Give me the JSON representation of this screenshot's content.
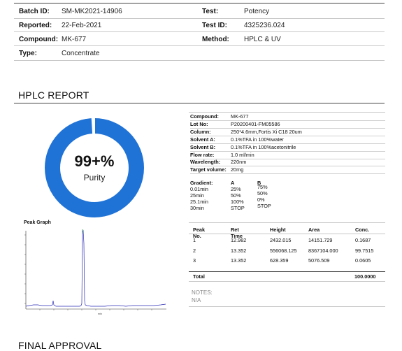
{
  "header": {
    "batch_id": {
      "label": "Batch ID:",
      "value": "SM-MK2021-14906"
    },
    "reported": {
      "label": "Reported:",
      "value": "22-Feb-2021"
    },
    "compound": {
      "label": "Compound:",
      "value": "MK-677"
    },
    "type": {
      "label": "Type:",
      "value": "Concentrate"
    },
    "test": {
      "label": "Test:",
      "value": "Potency"
    },
    "test_id": {
      "label": "Test ID:",
      "value": "4325236.024"
    },
    "method": {
      "label": "Method:",
      "value": "HPLC & UV"
    }
  },
  "hplc": {
    "title": "HPLC REPORT",
    "purity_value": "99+%",
    "purity_label": "Purity",
    "purity_fraction": 0.99,
    "ring_color": "#1f72d6",
    "peak_graph_title": "Peak Graph"
  },
  "specs": [
    {
      "key": "Compound:",
      "value": "MK-677"
    },
    {
      "key": "Lot No:",
      "value": "P20200401-FM05586"
    },
    {
      "key": "Column:",
      "value": "250*4.6mm,Fortis Xi C18 20um"
    },
    {
      "key": "Solvent A:",
      "value": "0.1%TFA in 100%water"
    },
    {
      "key": "Solvent B:",
      "value": "0.1%TFA in 100%acetonitrile"
    },
    {
      "key": "Flow rate:",
      "value": "1.0 ml/min"
    },
    {
      "key": "Wavelength:",
      "value": "220nm"
    },
    {
      "key": "Target volume:",
      "value": "20mg"
    }
  ],
  "gradient": {
    "label": "Gradient:",
    "col_a": "A",
    "col_b": "B",
    "rows": [
      {
        "time": "0.01min",
        "a": "25%",
        "b": "75%"
      },
      {
        "time": "25min",
        "a": "50%",
        "b": "50%"
      },
      {
        "time": "25.1min",
        "a": "100%",
        "b": "0%"
      },
      {
        "time": "30min",
        "a": "STOP",
        "b": "STOP"
      }
    ]
  },
  "peaks": {
    "headers": [
      "Peak No.",
      "Ret Time",
      "Height",
      "Area",
      "Conc."
    ],
    "rows": [
      [
        "1",
        "12.982",
        "2432.015",
        "14151.729",
        "0.1687"
      ],
      [
        "2",
        "13.352",
        "556068.125",
        "8367104.000",
        "99.7515"
      ],
      [
        "3",
        "13.352",
        "628.359",
        "5076.509",
        "0.0605"
      ]
    ],
    "total_label": "Total",
    "total_value": "100.0000"
  },
  "notes": {
    "label": "NOTES:",
    "value": "N/A"
  },
  "final_approval": {
    "title": "FINAL APPROVAL"
  }
}
